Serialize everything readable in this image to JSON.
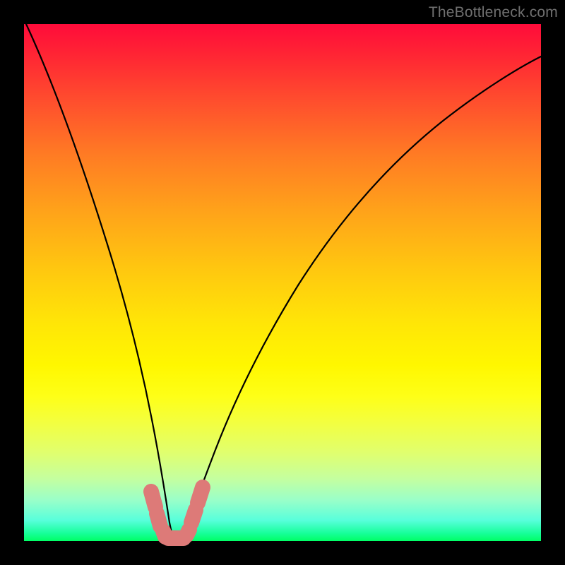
{
  "watermark": "TheBottleneck.com",
  "colors": {
    "frame": "#000000",
    "curve": "#000000",
    "marker": "#dd7a78",
    "gradient_top": "#ff0b3a",
    "gradient_bottom": "#00ff66"
  },
  "chart_data": {
    "type": "line",
    "title": "",
    "xlabel": "",
    "ylabel": "",
    "xlim": [
      0,
      100
    ],
    "ylim": [
      0,
      100
    ],
    "grid": false,
    "legend": false,
    "annotations": [
      "TheBottleneck.com"
    ],
    "series": [
      {
        "name": "bottleneck-curve",
        "x": [
          0,
          4,
          8,
          12,
          16,
          20,
          22,
          24,
          26,
          27,
          28,
          29,
          30,
          32,
          34,
          37,
          41,
          46,
          52,
          60,
          70,
          82,
          94,
          100
        ],
        "values": [
          100,
          84,
          68,
          53,
          39,
          25,
          18,
          12,
          6,
          3,
          1,
          0,
          0,
          1,
          5,
          12,
          22,
          33,
          45,
          58,
          70,
          81,
          90,
          94
        ]
      }
    ],
    "markers": {
      "description": "salmon rounded segments near curve minimum",
      "points_xy": [
        [
          24.2,
          9.5
        ],
        [
          25.4,
          5.0
        ],
        [
          26.4,
          2.2
        ],
        [
          28.5,
          0.8
        ],
        [
          30.6,
          2.2
        ],
        [
          31.8,
          6.0
        ],
        [
          32.8,
          10.5
        ]
      ]
    },
    "background": {
      "type": "vertical-gradient",
      "meaning": "red=high bottleneck, green=low bottleneck"
    }
  }
}
